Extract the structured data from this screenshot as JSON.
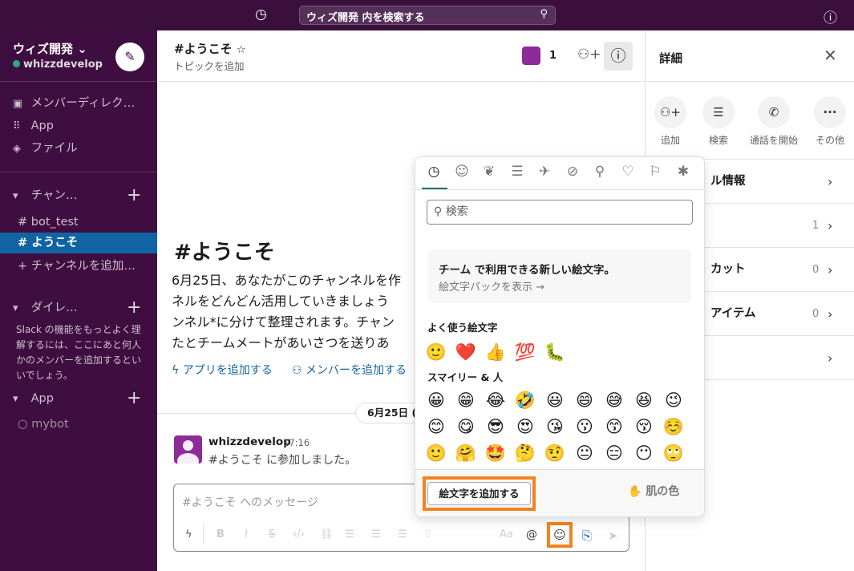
{
  "topbar": {
    "search_placeholder": "ウィズ開発 内を検索する",
    "history_icon": "clock-icon",
    "help_icon": "help-icon"
  },
  "sidebar": {
    "workspace": "ウィズ開発",
    "user": "whizzdevelop",
    "status_color": "#2bac76",
    "nav": [
      {
        "icon": "member-directory-icon",
        "label": "メンバーディレク…"
      },
      {
        "icon": "apps-grid-icon",
        "label": "App"
      },
      {
        "icon": "layers-icon",
        "label": "ファイル"
      }
    ],
    "channels_header": "チャン…",
    "channels": [
      {
        "label": "bot_test",
        "active": false
      },
      {
        "label": "ようこそ",
        "active": true
      }
    ],
    "add_channel": "チャンネルを追加…",
    "dm_header": "ダイレ…",
    "dm_note": "Slack の機能をもっとよく理解するには、ここにあと何人かのメンバーを追加するといいでしょう。",
    "apps_header": "App",
    "apps": [
      {
        "label": "mybot"
      }
    ],
    "active_color": "#1164a3"
  },
  "channel": {
    "name": "#ようこそ",
    "topic": "トピックを追加",
    "member_count": "1"
  },
  "intro": {
    "title": "#ようこそ",
    "lines": [
      "6月25日、あなたがこのチャンネルを作",
      "ネルをどんどん活用していきましょう",
      "ンネル*に分けて整理されます。チャン",
      "たとチームメートがあいさつを送りあ"
    ],
    "add_app": "アプリを追加する",
    "add_member": "メンバーを追加する"
  },
  "date_divider": "6月25日 (",
  "message": {
    "author": "whizzdevelop",
    "time": "17:16",
    "text": "#ようこそ に参加しました。"
  },
  "composer": {
    "placeholder": "#ようこそ へのメッセージ"
  },
  "details": {
    "title": "詳細",
    "actions": [
      {
        "icon": "add-user-icon",
        "label": "追加"
      },
      {
        "icon": "search-list-icon",
        "label": "検索"
      },
      {
        "icon": "phone-icon",
        "label": "通話を開始"
      },
      {
        "icon": "more-icon",
        "label": "その他"
      }
    ],
    "rows": [
      {
        "label": "ル情報",
        "count": ""
      },
      {
        "label": "",
        "count": "1"
      },
      {
        "label": "カット",
        "count": "0"
      },
      {
        "label": "アイテム",
        "count": "0"
      },
      {
        "label": "",
        "count": ""
      }
    ]
  },
  "emoji_picker": {
    "tabs": [
      "recent",
      "smileys",
      "nature",
      "food",
      "travel",
      "activities",
      "objects",
      "symbols",
      "flags",
      "slack"
    ],
    "search_placeholder": "検索",
    "promo_title": "チーム で利用できる新しい絵文字。",
    "promo_link": "絵文字パックを表示 →",
    "frequent_header": "よく使う絵文字",
    "frequent": [
      "🙂",
      "❤️",
      "👍",
      "💯",
      "🐛"
    ],
    "smileys_header": "スマイリー & 人",
    "smileys": [
      "😀",
      "😁",
      "😂",
      "🤣",
      "😃",
      "😄",
      "😅",
      "😆",
      "😉",
      "😊",
      "😋",
      "😎",
      "😍",
      "😘",
      "😗",
      "😙",
      "😚",
      "☺️",
      "🙂",
      "🤗",
      "🤩",
      "🤔",
      "🤨",
      "😐",
      "😑",
      "😶",
      "🙄"
    ],
    "add_emoji": "絵文字を追加する",
    "skin_tone": "肌の色",
    "skin_tone_emoji": "✋",
    "highlight_color": "#f58220",
    "accent": "#007a5a"
  }
}
